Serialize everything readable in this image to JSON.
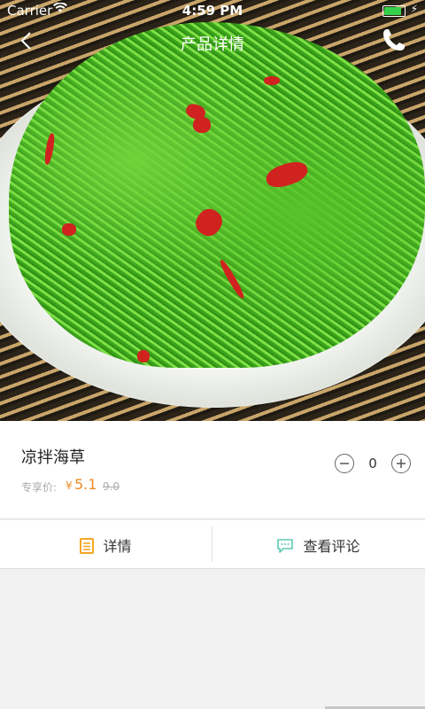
{
  "status_bar": {
    "carrier": "Carrier",
    "time": "4:59 PM",
    "battery_level": 0.95
  },
  "nav": {
    "title": "产品详情",
    "back_icon": "chevron-left-icon",
    "phone_icon": "phone-icon"
  },
  "product": {
    "name": "凉拌海草",
    "price_label": "专享价:",
    "currency": "¥",
    "price": "5.1",
    "original_price": "9.0",
    "quantity": "0",
    "decrement_icon": "minus-circle-icon",
    "increment_icon": "plus-circle-icon"
  },
  "tabs": [
    {
      "label": "详情",
      "icon": "document-icon",
      "icon_color": "#f5a623"
    },
    {
      "label": "查看评论",
      "icon": "chat-bubble-icon",
      "icon_color": "#5ec9b0"
    }
  ],
  "colors": {
    "accent": "#f08a26",
    "battery": "#36d14a"
  }
}
